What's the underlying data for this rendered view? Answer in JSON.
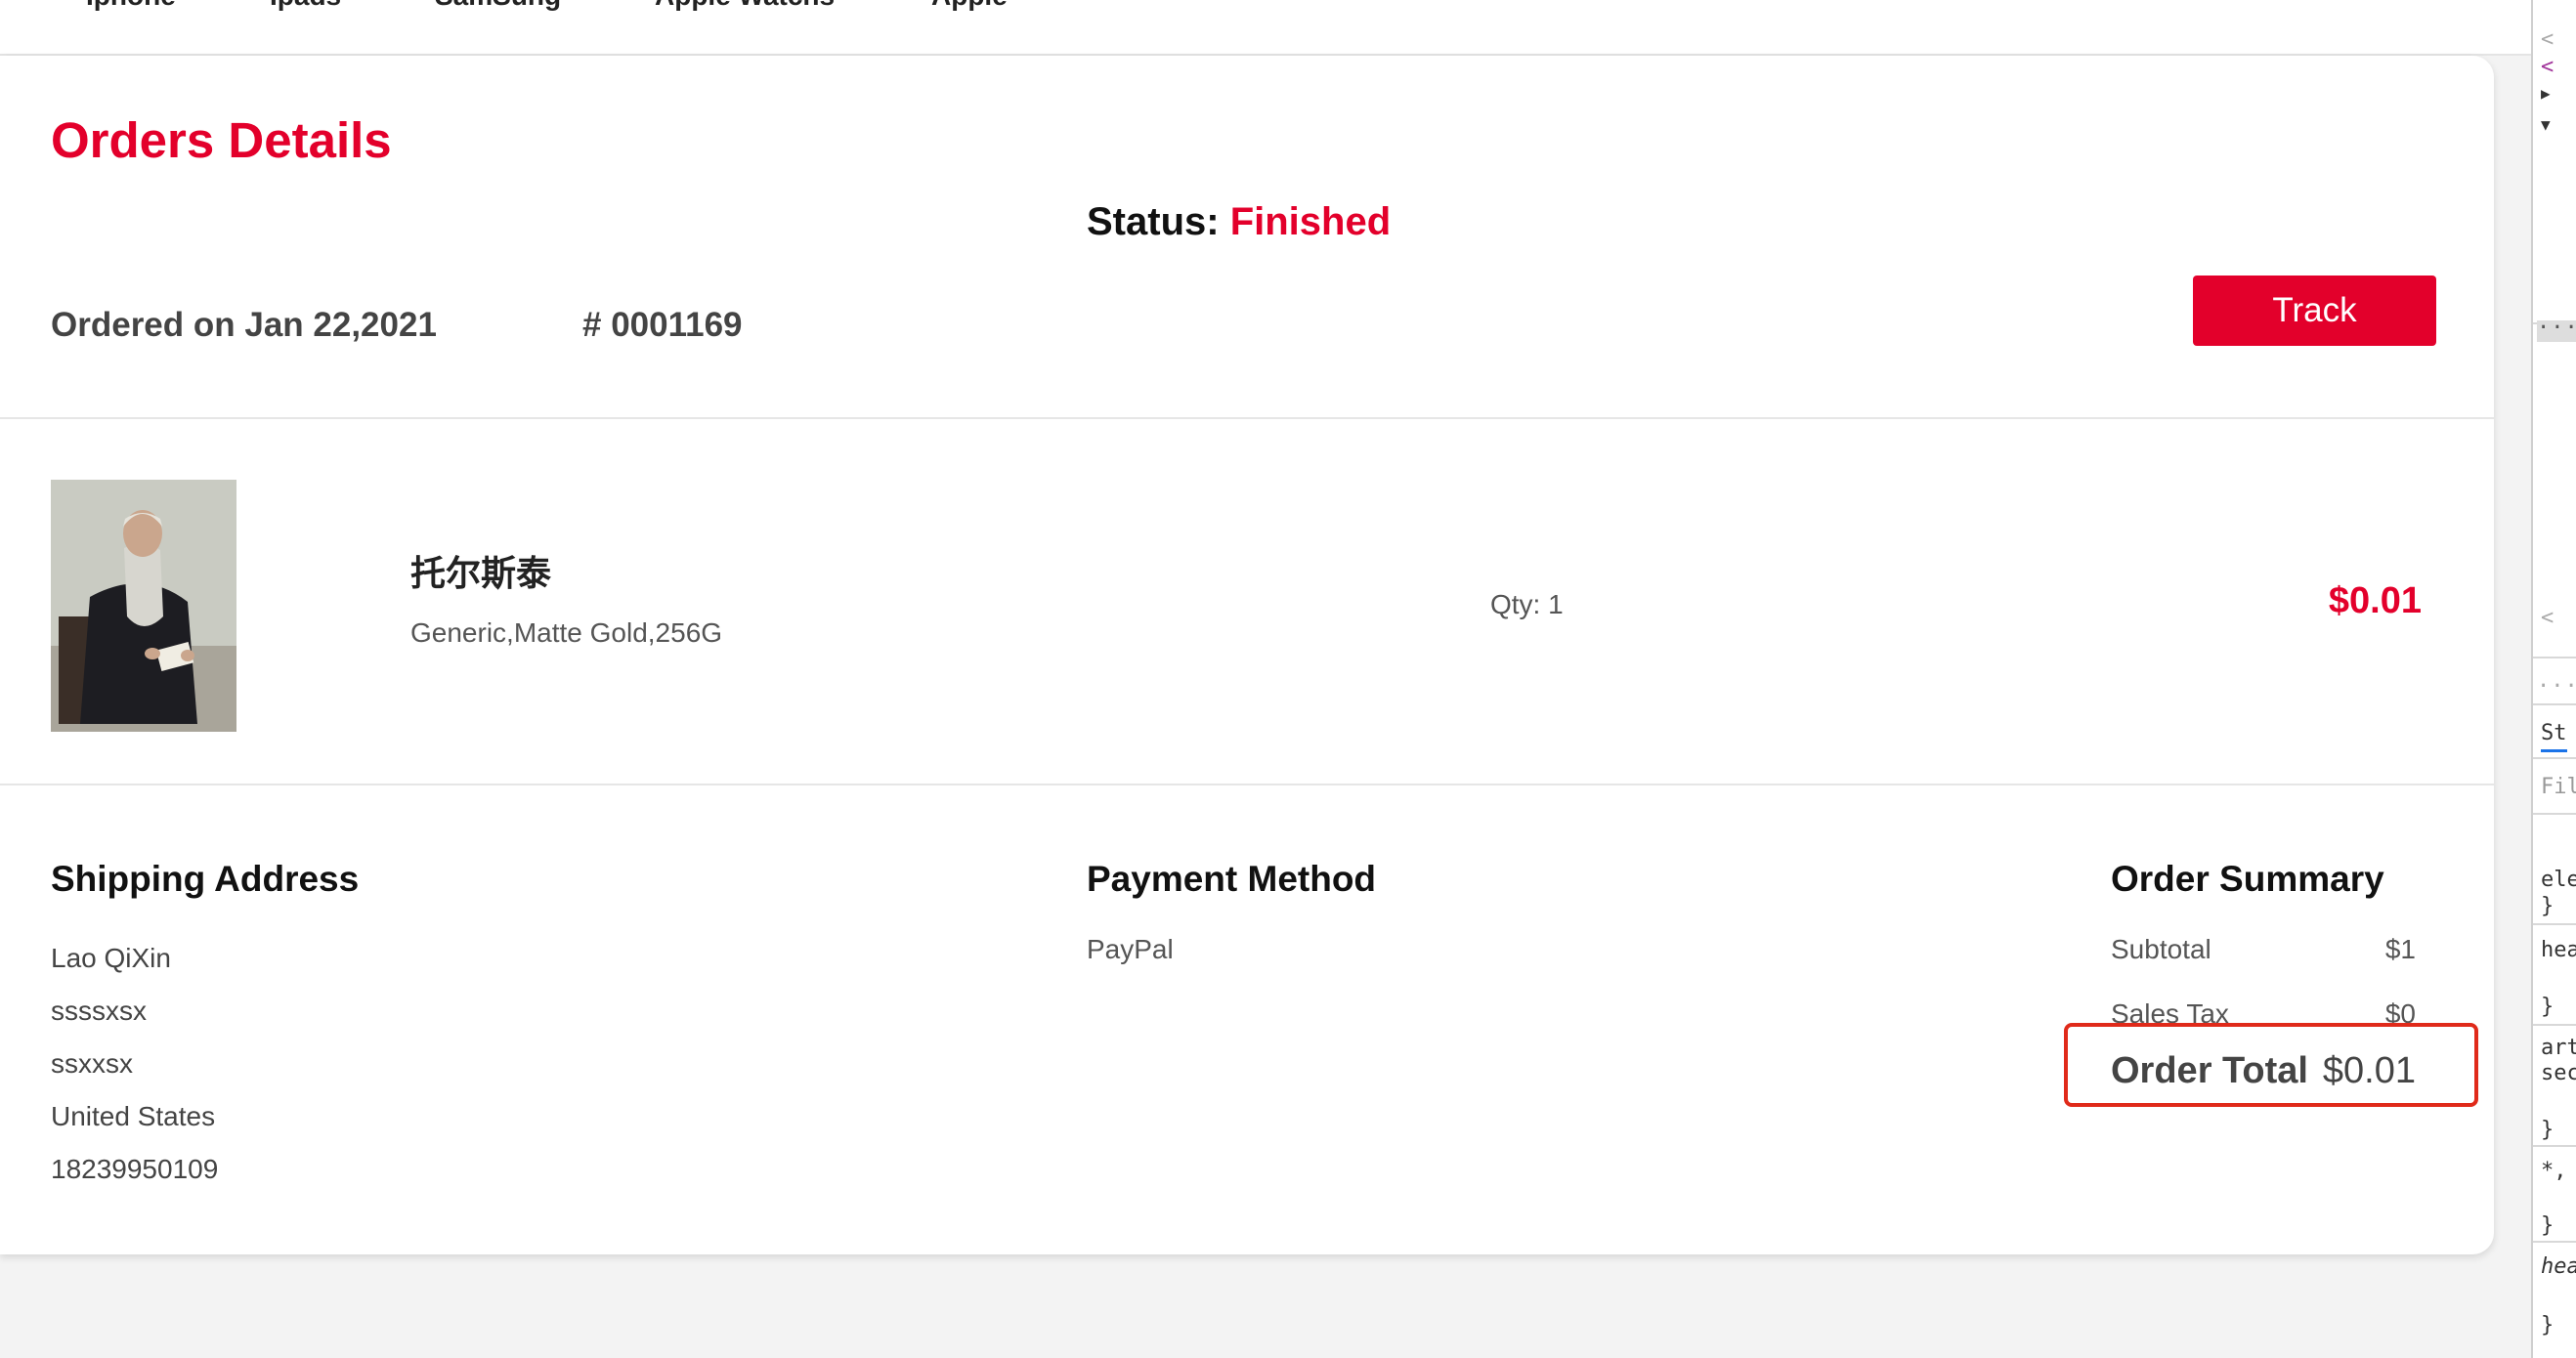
{
  "nav": {
    "items": [
      "Iphone",
      "Ipads",
      "SamSung",
      "Apple Watchs",
      "Apple"
    ]
  },
  "order": {
    "title": "Orders Details",
    "status_label": "Status:",
    "status_value": "Finished",
    "ordered_on": "Ordered on Jan 22,2021",
    "order_number": "# 0001169",
    "track_label": "Track"
  },
  "item": {
    "name": "托尔斯泰",
    "variant": "Generic,Matte Gold,256G",
    "qty": "Qty: 1",
    "price": "$0.01"
  },
  "shipping": {
    "title": "Shipping Address",
    "lines": [
      "Lao QiXin",
      "ssssxsx",
      "ssxxsx",
      "United States",
      "18239950109"
    ]
  },
  "payment": {
    "title": "Payment Method",
    "method": "PayPal"
  },
  "summary": {
    "title": "Order Summary",
    "subtotal_label": "Subtotal",
    "subtotal_value": "$1",
    "tax_label": "Sales Tax",
    "tax_value": "$0",
    "total_label": "Order Total",
    "total_value": "$0.01"
  },
  "devtools": {
    "tab_label": "St",
    "filter_placeholder": "Filt",
    "rule_snippets": [
      "ele",
      "}",
      "hea",
      "}",
      "art",
      "sec",
      "}",
      "*,",
      "}",
      "hea",
      "}"
    ]
  },
  "colors": {
    "accent": "#e3002b",
    "highlight": "#e02a1a"
  }
}
